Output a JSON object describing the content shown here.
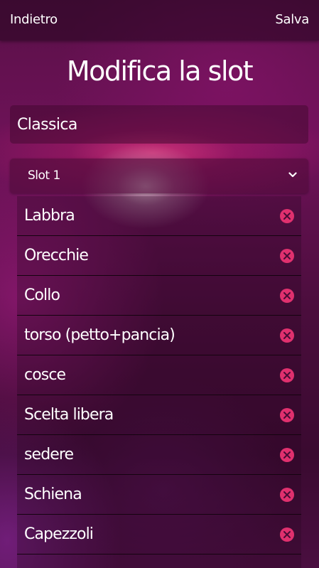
{
  "header": {
    "back_label": "Indietro",
    "save_label": "Salva"
  },
  "page": {
    "title": "Modifica la slot"
  },
  "form": {
    "name_value": "Classica",
    "slot_select": {
      "selected": "Slot 1",
      "options": [
        "Slot 1"
      ]
    }
  },
  "items": [
    {
      "label": "Labbra"
    },
    {
      "label": "Orecchie"
    },
    {
      "label": "Collo"
    },
    {
      "label": "torso (petto+pancia)"
    },
    {
      "label": "cosce"
    },
    {
      "label": "Scelta libera"
    },
    {
      "label": "sedere"
    },
    {
      "label": "Schiena"
    },
    {
      "label": "Capezzoli"
    },
    {
      "label": ""
    }
  ],
  "icons": {
    "remove": "remove-circle-icon",
    "dropdown": "chevron-down-icon"
  },
  "colors": {
    "accent": "#e0306e",
    "background": "#5a1048"
  }
}
